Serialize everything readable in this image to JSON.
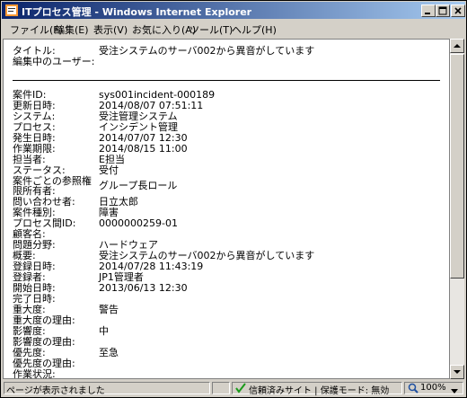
{
  "window": {
    "title": "ITプロセス管理 - Windows Internet Explorer"
  },
  "menu": {
    "items": [
      "ファイル(F)",
      "編集(E)",
      "表示(V)",
      "お気に入り(A)",
      "ツール(T)",
      "ヘルプ(H)"
    ]
  },
  "header": {
    "title_label": "タイトル:",
    "title_value": "受注システムのサーバ002から異音がしています",
    "editing_user_label": "編集中のユーザー:",
    "editing_user_value": ""
  },
  "fields": [
    {
      "label": "案件ID:",
      "value": "sys001incident-000189"
    },
    {
      "label": "更新日時:",
      "value": "2014/08/07 07:51:11"
    },
    {
      "label": "システム:",
      "value": "受注管理システム"
    },
    {
      "label": "プロセス:",
      "value": "インシデント管理"
    },
    {
      "label": "発生日時:",
      "value": "2014/07/07 12:30"
    },
    {
      "label": "作業期限:",
      "value": "2014/08/15 11:00"
    },
    {
      "label": "担当者:",
      "value": "E担当"
    },
    {
      "label": "ステータス:",
      "value": "受付"
    },
    {
      "label": "案件ごとの参照権限所有者:",
      "label_lines": [
        "案件ごとの参照権",
        "限所有者:"
      ],
      "value": "グループ長ロール"
    },
    {
      "label": "問い合わせ者:",
      "value": "日立太郎"
    },
    {
      "label": "案件種別:",
      "value": "障害"
    },
    {
      "label": "プロセス間ID:",
      "value": "0000000259-01"
    },
    {
      "label": "顧客名:",
      "value": ""
    },
    {
      "label": "問題分野:",
      "value": "ハードウェア"
    },
    {
      "label": "概要:",
      "value": "受注システムのサーバ002から異音がしています"
    },
    {
      "label": "登録日時:",
      "value": "2014/07/28 11:43:19"
    },
    {
      "label": "登録者:",
      "value": "JP1管理者"
    },
    {
      "label": "開始日時:",
      "value": "2013/06/13 12:30"
    },
    {
      "label": "完了日時:",
      "value": ""
    },
    {
      "label": "重大度:",
      "value": "警告"
    },
    {
      "label": "重大度の理由:",
      "value": ""
    },
    {
      "label": "影響度:",
      "value": "中"
    },
    {
      "label": "影響度の理由:",
      "value": ""
    },
    {
      "label": "優先度:",
      "value": "至急"
    },
    {
      "label": "優先度の理由:",
      "value": ""
    },
    {
      "label": "作業状況:",
      "value": ""
    }
  ],
  "status": {
    "left": "ページが表示されました",
    "zone": "信頼済みサイト | 保護モード: 無効",
    "zoom": "100%"
  }
}
